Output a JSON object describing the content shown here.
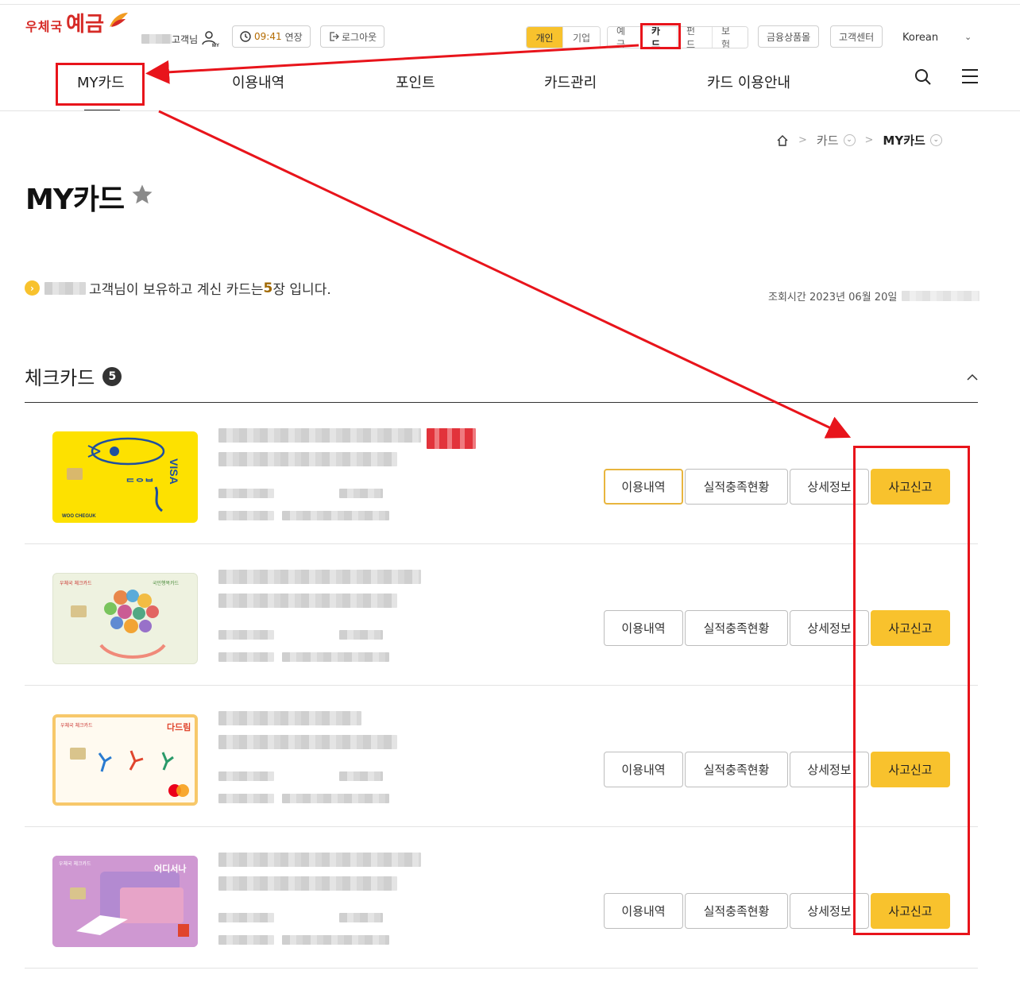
{
  "header": {
    "logo_small": "우체국",
    "logo_big": "예금",
    "user_suffix": "고객님",
    "session_time": "09:41",
    "extend_label": "연장",
    "logout_label": "로그아웃",
    "segment_customer": [
      {
        "label": "개인",
        "active": true
      },
      {
        "label": "기업",
        "active": false
      }
    ],
    "segment_products": [
      {
        "label": "예금"
      },
      {
        "label": "카드"
      },
      {
        "label": "펀드"
      },
      {
        "label": "보험"
      }
    ],
    "finance_mall": "금융상품몰",
    "customer_center": "고객센터",
    "language": "Korean"
  },
  "gnb": [
    "MY카드",
    "이용내역",
    "포인트",
    "카드관리",
    "카드 이용안내"
  ],
  "breadcrumb": {
    "level1": "카드",
    "level2": "MY카드"
  },
  "page_title": "MY카드",
  "summary": {
    "prefix": "고객님이 보유하고 계신 카드는",
    "count": "5",
    "suffix": "장 입니다."
  },
  "query_time": {
    "label": "조회시간",
    "date": "2023년 06월 20일"
  },
  "section": {
    "title": "체크카드",
    "count": "5"
  },
  "cards": [
    {
      "card_text": "WOO CHEGUK",
      "brand": "VISA"
    },
    {
      "card_text": "우체국 체크카드",
      "brand": "국민행복카드"
    },
    {
      "card_text": "우체국 체크카드",
      "brand": "다드림"
    },
    {
      "card_text": "우체국 체크카드",
      "brand": "어디서나"
    }
  ],
  "buttons": {
    "history": "이용내역",
    "performance": "실적충족현황",
    "details": "상세정보",
    "report": "사고신고"
  },
  "colors": {
    "accent": "#f8c22d",
    "brand_red": "#d62a26",
    "annotation": "#e8141b"
  }
}
